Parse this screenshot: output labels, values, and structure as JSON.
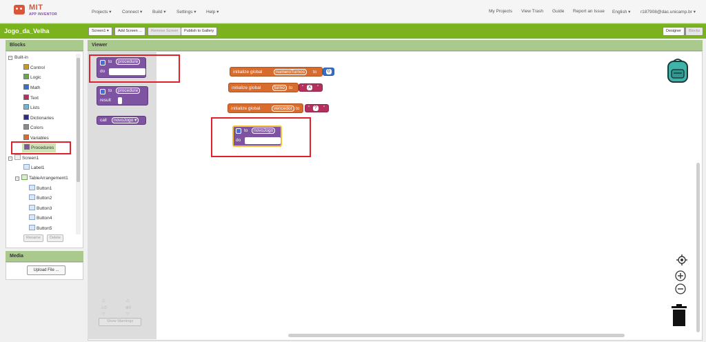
{
  "logo": {
    "brand": "MIT",
    "product": "APP INVENTOR"
  },
  "top_menu": [
    "Projects ▾",
    "Connect ▾",
    "Build ▾",
    "Settings ▾",
    "Help ▾"
  ],
  "top_right": [
    "My Projects",
    "View Trash",
    "Guide",
    "Report an Issue",
    "English ▾",
    "r187908@dac.unicamp.br ▾"
  ],
  "project_title": "Jogo_da_Velha",
  "toolbar": {
    "screen_select": "Screen1 ▾",
    "add_screen": "Add Screen ...",
    "remove_screen": "Remove Screen",
    "publish": "Publish to Gallery",
    "designer": "Designer",
    "blocks": "Blocks"
  },
  "blocks_panel": {
    "title": "Blocks",
    "builtin_label": "Built-in",
    "builtin": [
      {
        "label": "Control",
        "color": "#c99a1e"
      },
      {
        "label": "Logic",
        "color": "#6aa84f"
      },
      {
        "label": "Math",
        "color": "#3b6ec7"
      },
      {
        "label": "Text",
        "color": "#b3305f"
      },
      {
        "label": "Lists",
        "color": "#6fb4d8"
      },
      {
        "label": "Dictionaries",
        "color": "#2c2a8f"
      },
      {
        "label": "Colors",
        "color": "#8a8a8a"
      },
      {
        "label": "Variables",
        "color": "#d86c2e"
      },
      {
        "label": "Procedures",
        "color": "#7e53a1"
      }
    ],
    "screen_label": "Screen1",
    "components": [
      "Label1",
      "TableArrangement1",
      "Button1",
      "Button2",
      "Button3",
      "Button4",
      "Button5"
    ],
    "rename": "Rename",
    "delete": "Delete"
  },
  "media_panel": {
    "title": "Media",
    "upload": "Upload File ..."
  },
  "viewer": {
    "title": "Viewer",
    "flyout": {
      "to": "to",
      "procedure": "procedure",
      "do": "do",
      "result": "result",
      "call": "call",
      "call_name": "novoJogo ▾"
    },
    "globals": [
      {
        "prefix": "initialize global",
        "name": "numeroTurnos",
        "to": "to",
        "value": "0"
      },
      {
        "prefix": "initialize global",
        "name": "turno",
        "to": "to",
        "value": "X"
      },
      {
        "prefix": "initialize global",
        "name": "vencedor",
        "to": "to",
        "value": "?"
      }
    ],
    "proc": {
      "to": "to",
      "name": "novoJogo",
      "do": "do"
    },
    "warnings": {
      "warn_count": "0",
      "error_count": "0",
      "show_warnings": "Show Warnings"
    }
  }
}
